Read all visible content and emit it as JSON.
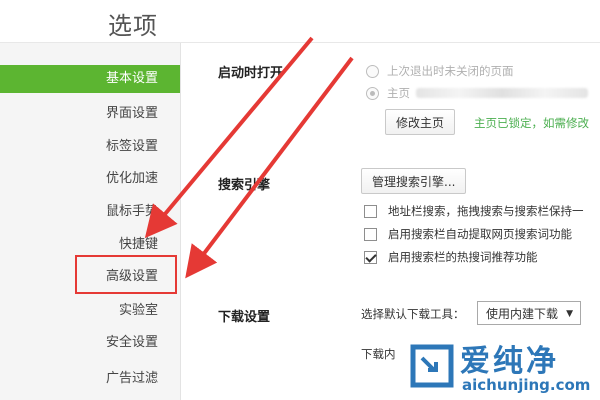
{
  "page": {
    "title": "选项"
  },
  "sidebar": {
    "items": [
      {
        "label": "基本设置",
        "active": true
      },
      {
        "label": "界面设置"
      },
      {
        "label": "标签设置"
      },
      {
        "label": "优化加速"
      },
      {
        "label": "鼠标手势"
      },
      {
        "label": "快捷键"
      },
      {
        "label": "高级设置",
        "highlighted": true
      },
      {
        "label": "实验室"
      },
      {
        "label": "安全设置"
      },
      {
        "label": "广告过滤"
      }
    ]
  },
  "startup": {
    "label": "启动时打开",
    "option_last_session": "上次退出时未关闭的页面",
    "option_homepage_prefix": "主页",
    "modify_homepage_button": "修改主页",
    "homepage_locked_text": "主页已锁定，如需修改"
  },
  "search": {
    "label": "搜索引擎",
    "manage_button": "管理搜索引擎...",
    "options": [
      {
        "label": "地址栏搜索，拖拽搜索与搜索栏保持一",
        "checked": false
      },
      {
        "label": "启用搜索栏自动提取网页搜索词功能",
        "checked": false
      },
      {
        "label": "启用搜索栏的热搜词推荐功能",
        "checked": true
      }
    ]
  },
  "download": {
    "label": "下载设置",
    "tool_label": "选择默认下载工具：",
    "tool_value": "使用内建下载",
    "location_label": "下载内"
  },
  "watermark": {
    "brand": "爱纯净",
    "url": "aichunjing.com"
  },
  "colors": {
    "accent_green": "#5cb531",
    "annotation_red": "#e53935",
    "link_green": "#4caf50",
    "watermark_blue": "#2d77b8"
  }
}
